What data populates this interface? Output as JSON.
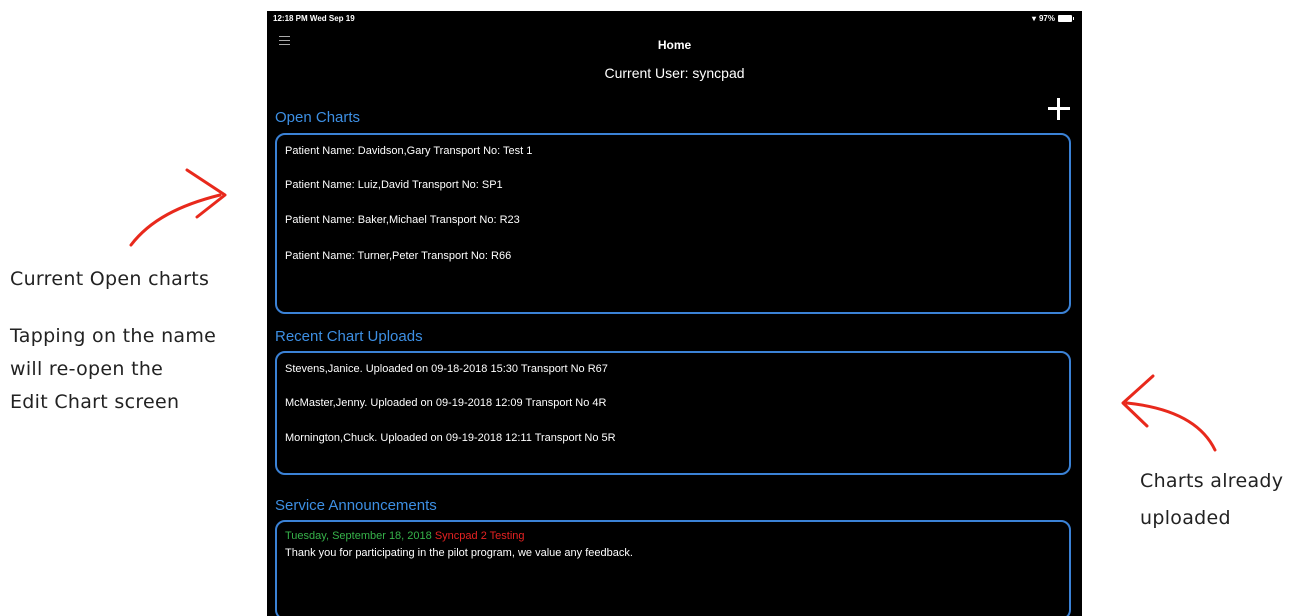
{
  "status_bar": {
    "time": "12:18 PM  Wed Sep 19",
    "battery": "97%"
  },
  "nav": {
    "title": "Home"
  },
  "current_user": "Current User: syncpad",
  "open_charts": {
    "title": "Open Charts",
    "items": [
      "Patient Name: Davidson,Gary Transport No: Test 1",
      "Patient Name: Luiz,David Transport No: SP1",
      "Patient Name: Baker,Michael Transport No: R23",
      "Patient Name: Turner,Peter Transport No: R66"
    ]
  },
  "recent_uploads": {
    "title": "Recent Chart Uploads",
    "items": [
      "Stevens,Janice. Uploaded on 09-18-2018 15:30 Transport No R67",
      "McMaster,Jenny. Uploaded on 09-19-2018 12:09 Transport No 4R",
      "Mornington,Chuck. Uploaded on 09-19-2018 12:11 Transport No 5R"
    ]
  },
  "announcements": {
    "title": "Service Announcements",
    "date": "Tuesday, September 18, 2018",
    "tag": "Syncpad 2 Testing",
    "message": "Thank you for participating in the pilot program, we value any feedback."
  },
  "annotations": {
    "left_line1": "Current Open charts",
    "left_line2": "Tapping on the name",
    "left_line3": "will re-open the",
    "left_line4": "Edit Chart screen",
    "right_line1": "Charts already",
    "right_line2": "uploaded"
  },
  "colors": {
    "accent": "#3d8fe3",
    "date": "#36b34a",
    "tag": "#e52222",
    "arrow": "#e8291c"
  }
}
